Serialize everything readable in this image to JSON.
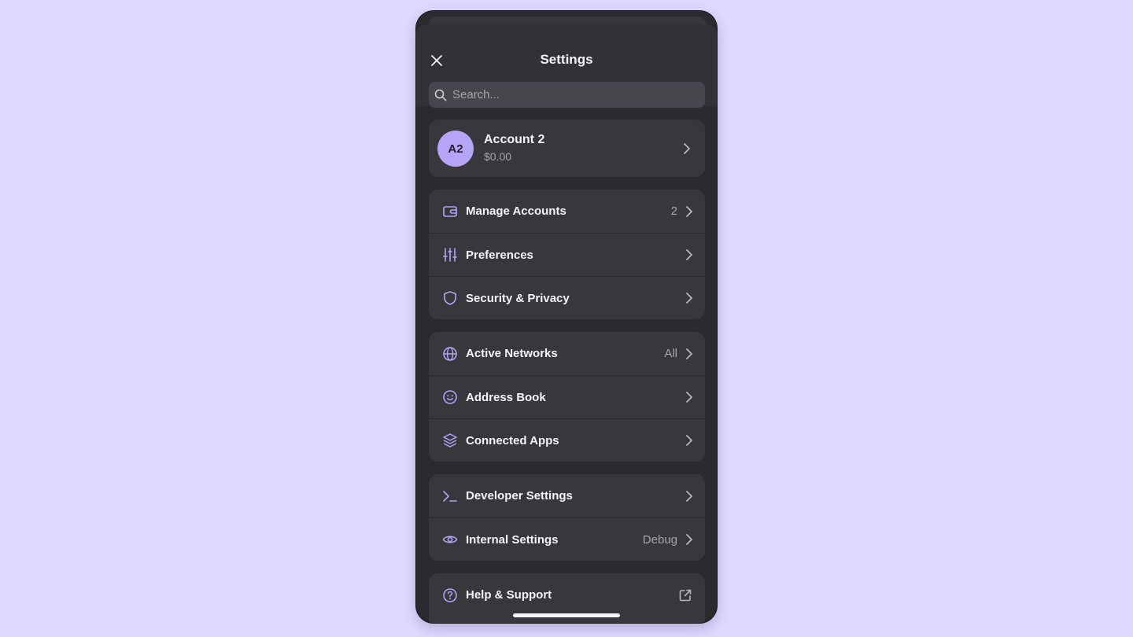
{
  "header": {
    "title": "Settings",
    "search_placeholder": "Search..."
  },
  "account": {
    "initials": "A2",
    "name": "Account 2",
    "balance": "$0.00"
  },
  "groups": [
    {
      "items": [
        {
          "label": "Manage Accounts",
          "value": "2",
          "icon": "wallet-icon"
        },
        {
          "label": "Preferences",
          "value": "",
          "icon": "sliders-icon"
        },
        {
          "label": "Security & Privacy",
          "value": "",
          "icon": "shield-icon"
        }
      ]
    },
    {
      "items": [
        {
          "label": "Active Networks",
          "value": "All",
          "icon": "globe-icon"
        },
        {
          "label": "Address Book",
          "value": "",
          "icon": "smiley-icon"
        },
        {
          "label": "Connected Apps",
          "value": "",
          "icon": "layers-icon"
        }
      ]
    },
    {
      "items": [
        {
          "label": "Developer Settings",
          "value": "",
          "icon": "terminal-icon"
        },
        {
          "label": "Internal Settings",
          "value": "Debug",
          "icon": "eye-icon"
        }
      ]
    },
    {
      "items": [
        {
          "label": "Help & Support",
          "value": "",
          "icon": "help-circle-icon"
        }
      ]
    }
  ],
  "colors": {
    "accent": "#b6a4f7",
    "background": "#dedaff",
    "panel": "#2b2a2f",
    "card": "#38373c"
  }
}
